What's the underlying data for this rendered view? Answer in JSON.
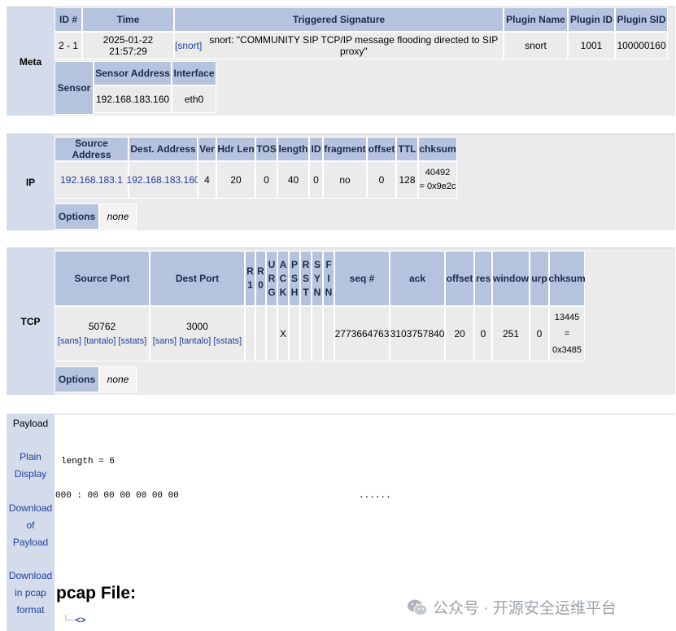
{
  "meta": {
    "section_label": "Meta",
    "headers": [
      "ID #",
      "Time",
      "Triggered Signature",
      "Plugin Name",
      "Plugin ID",
      "Plugin SID"
    ],
    "row": {
      "id": "2 - 1",
      "time": "2025-01-22 21:57:29",
      "sig_prefix": "[snort]",
      "sig_text": "snort: \"COMMUNITY SIP TCP/IP message flooding directed to SIP proxy\"",
      "plugin_name": "snort",
      "plugin_id": "1001",
      "plugin_sid": "100000160"
    },
    "sensor": {
      "label": "Sensor",
      "headers": [
        "Sensor Address",
        "Interface"
      ],
      "address": "192.168.183.160",
      "interface": "eth0"
    }
  },
  "ip": {
    "section_label": "IP",
    "headers": [
      "Source Address",
      "Dest. Address",
      "Ver",
      "Hdr Len",
      "TOS",
      "length",
      "ID",
      "fragment",
      "offset",
      "TTL",
      "chksum"
    ],
    "values": {
      "src": "192.168.183.1",
      "dst": "192.168.183.160",
      "ver": "4",
      "hdr_len": "20",
      "tos": "0",
      "length": "40",
      "id": "0",
      "fragment": "no",
      "offset": "0",
      "ttl": "128",
      "chksum_line1": "40492",
      "chksum_line2": "= 0x9e2c"
    },
    "options_label": "Options",
    "options_value": "none"
  },
  "tcp": {
    "section_label": "TCP",
    "headers": {
      "src_port": "Source Port",
      "dst_port": "Dest Port",
      "r1": [
        "R",
        "1"
      ],
      "r0": [
        "R",
        "0"
      ],
      "urg": [
        "U",
        "R",
        "G"
      ],
      "ack_flag": [
        "A",
        "C",
        "K"
      ],
      "psh": [
        "P",
        "S",
        "H"
      ],
      "rst": [
        "R",
        "S",
        "T"
      ],
      "syn": [
        "S",
        "Y",
        "N"
      ],
      "fin": [
        "F",
        "I",
        "N"
      ],
      "seq": "seq #",
      "ack": "ack",
      "offset": "offset",
      "res": "res",
      "window": "window",
      "urp": "urp",
      "chksum": "chksum"
    },
    "values": {
      "src_port": "50762",
      "dst_port": "3000",
      "ack_flag": "X",
      "seq": "2773664763",
      "ack": "3103757840",
      "offset": "20",
      "res": "0",
      "window": "251",
      "urp": "0",
      "chksum_line1": "13445",
      "chksum_line2": "=",
      "chksum_line3": "0x3485"
    },
    "port_links": [
      "[sans]",
      "[tantalo]",
      "[sstats]"
    ],
    "options_label": "Options",
    "options_value": "none"
  },
  "payload": {
    "side_title": "Payload",
    "plain_display": [
      "Plain",
      "Display"
    ],
    "download_payload": [
      "Download",
      "of",
      "Payload"
    ],
    "download_pcap": [
      "Download",
      "in pcap",
      "format"
    ],
    "length_line": "length = 6",
    "hex_line": "000 : 00 00 00 00 00 00",
    "ascii_line": "......",
    "pcap_heading": "pcap File:",
    "tree_arrow": "<>"
  },
  "watermark": "公众号 · 开源安全运维平台"
}
